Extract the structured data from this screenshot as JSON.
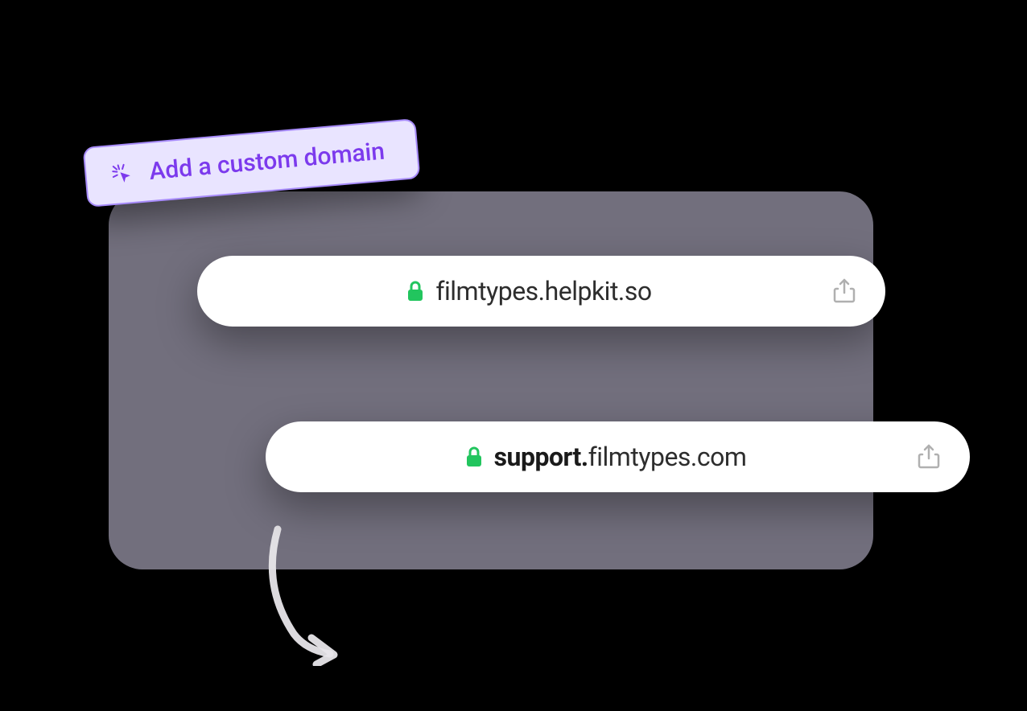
{
  "badge": {
    "label": "Add a custom domain"
  },
  "addressBar1": {
    "url": "filmtypes.helpkit.so"
  },
  "addressBar2": {
    "urlBold": "support.",
    "urlRest": "filmtypes.com"
  },
  "colors": {
    "badgeBg": "#e9e4ff",
    "badgeBorder": "#a78bfa",
    "badgeText": "#7c3aed",
    "cardBg": "#726f7d",
    "lockGreen": "#22c55e"
  }
}
